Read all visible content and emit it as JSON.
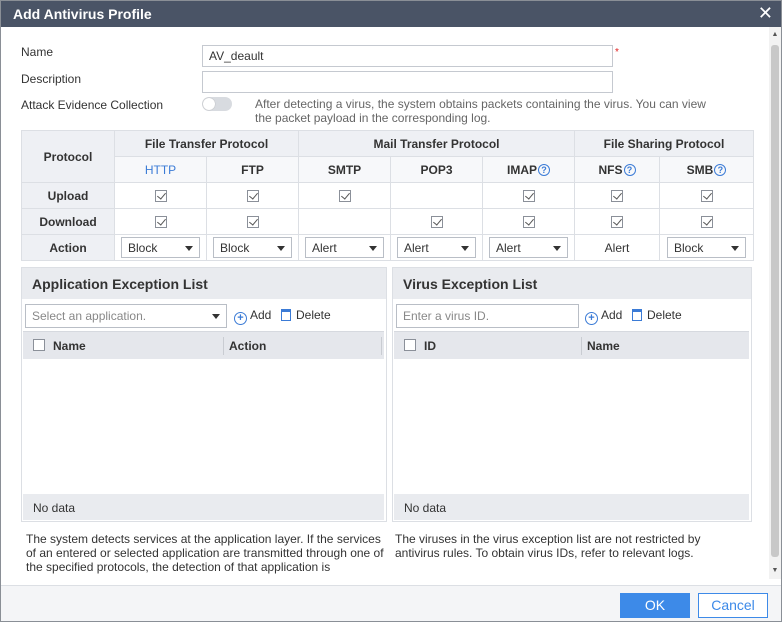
{
  "dialog": {
    "title": "Add Antivirus Profile",
    "close_glyph": "✕"
  },
  "form": {
    "name_label": "Name",
    "name_value": "AV_deault",
    "required_mark": "*",
    "description_label": "Description",
    "description_value": "",
    "evidence_label": "Attack Evidence Collection",
    "evidence_enabled": false,
    "evidence_hint": "After detecting a virus, the system obtains packets containing the virus. You can view the packet payload in the corresponding log."
  },
  "protocol_table": {
    "protocol_header": "Protocol",
    "groups": [
      "File Transfer Protocol",
      "Mail Transfer Protocol",
      "File Sharing Protocol"
    ],
    "protocols": [
      "HTTP",
      "FTP",
      "SMTP",
      "POP3",
      "IMAP",
      "NFS",
      "SMB"
    ],
    "rows": {
      "upload_label": "Upload",
      "download_label": "Download",
      "action_label": "Action"
    },
    "upload": [
      true,
      true,
      true,
      null,
      true,
      true,
      true
    ],
    "download": [
      true,
      true,
      null,
      true,
      true,
      true,
      true
    ],
    "actions": [
      "Block",
      "Block",
      "Alert",
      "Alert",
      "Alert",
      "Alert",
      "Block"
    ]
  },
  "app_exception": {
    "title": "Application Exception List",
    "select_placeholder": "Select an application.",
    "add_label": "Add",
    "delete_label": "Delete",
    "col_name": "Name",
    "col_action": "Action",
    "empty_text": "No data",
    "note": "The system detects services at the application layer. If the services of an entered or selected application are transmitted through one of the specified protocols, the detection of that application is"
  },
  "virus_exception": {
    "title": "Virus Exception List",
    "input_placeholder": "Enter a virus ID.",
    "add_label": "Add",
    "delete_label": "Delete",
    "col_id": "ID",
    "col_name": "Name",
    "empty_text": "No data",
    "note": "The viruses in the virus exception list are not restricted by antivirus rules. To obtain virus IDs, refer to relevant logs."
  },
  "footer": {
    "ok_label": "OK",
    "cancel_label": "Cancel"
  },
  "colors": {
    "titlebar": "#4a5466",
    "accent": "#3d8ae8",
    "link": "#3b7bd6",
    "required": "#e02020"
  }
}
